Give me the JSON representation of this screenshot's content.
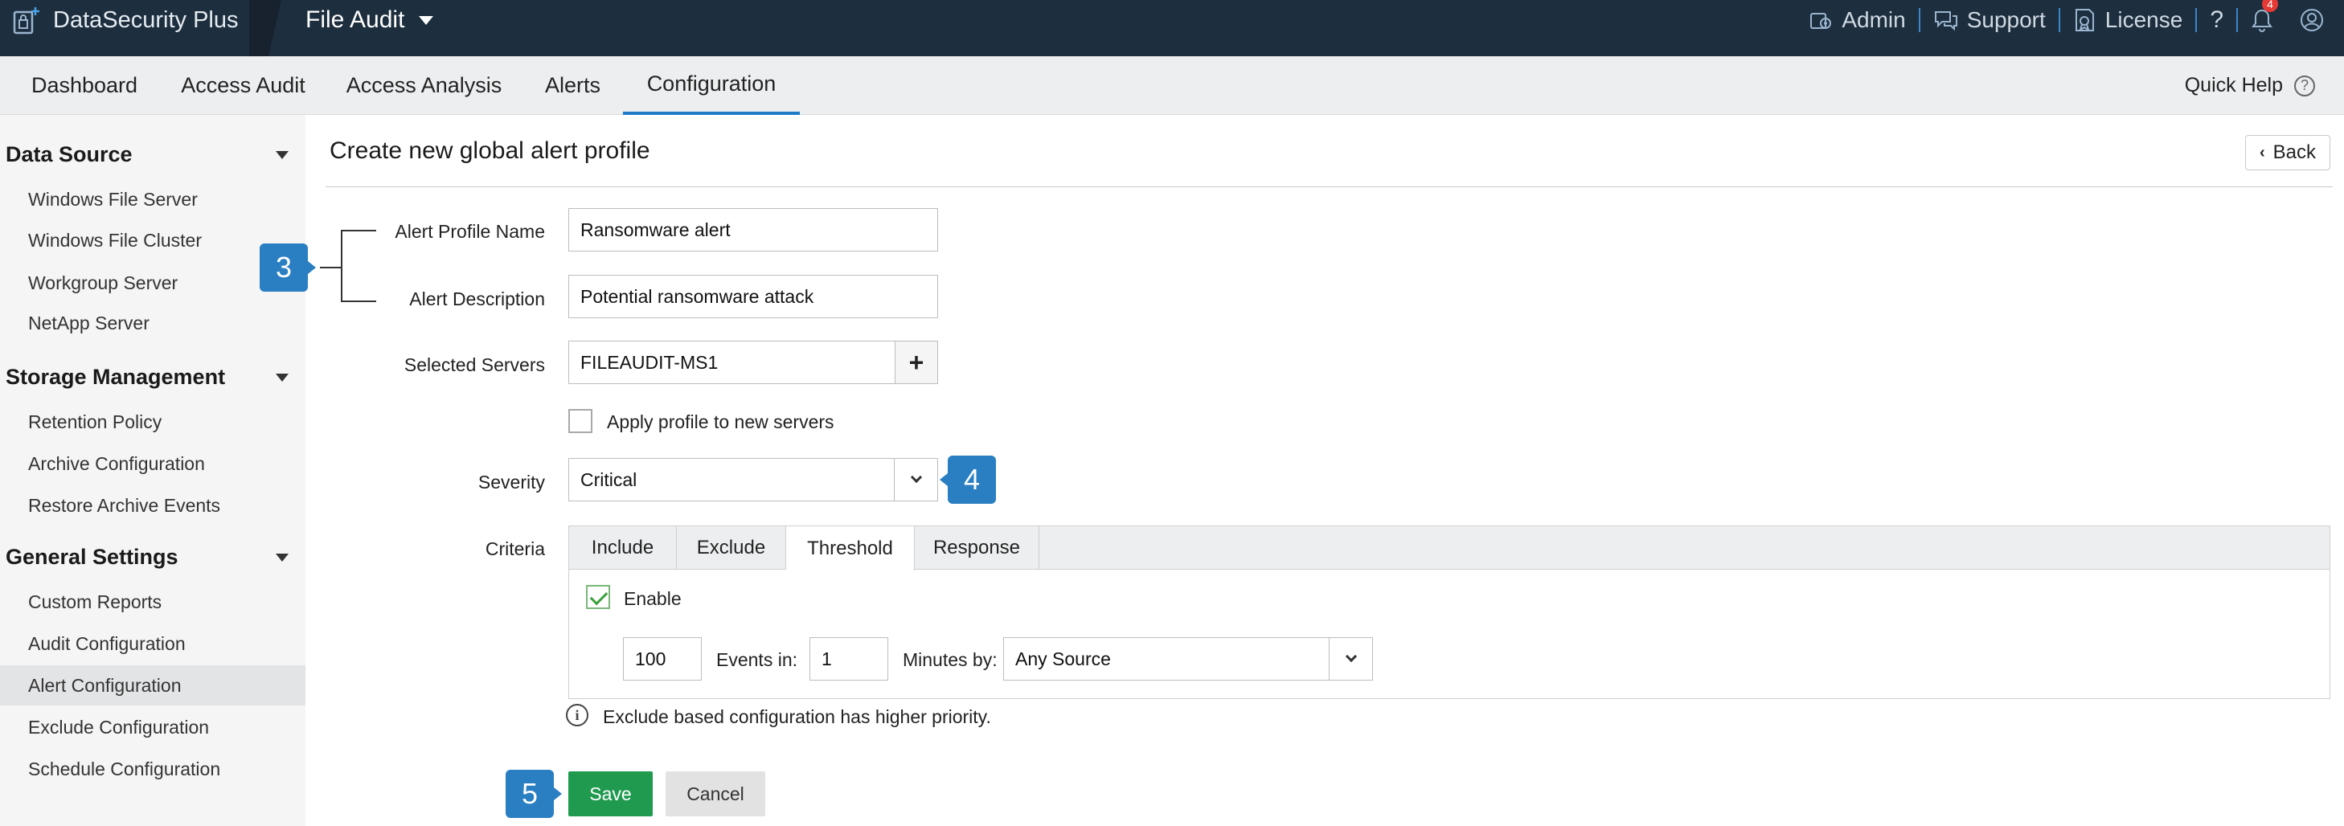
{
  "app": {
    "brand_name": "DataSecurity Plus",
    "product": "File Audit"
  },
  "top_links": {
    "admin": "Admin",
    "support": "Support",
    "license": "License",
    "help": "?",
    "notification_count": "4"
  },
  "nav": {
    "tabs": [
      "Dashboard",
      "Access Audit",
      "Access Analysis",
      "Alerts",
      "Configuration"
    ],
    "active": "Configuration",
    "quick_help": "Quick Help",
    "quick_help_icon": "?"
  },
  "sidebar": {
    "sections": [
      {
        "title": "Data Source",
        "items": [
          "Windows File Server",
          "Windows File Cluster",
          "Workgroup Server",
          "NetApp Server"
        ]
      },
      {
        "title": "Storage Management",
        "items": [
          "Retention Policy",
          "Archive Configuration",
          "Restore Archive Events"
        ]
      },
      {
        "title": "General Settings",
        "items": [
          "Custom Reports",
          "Audit Configuration",
          "Alert Configuration",
          "Exclude Configuration",
          "Schedule Configuration"
        ]
      }
    ],
    "active_item": "Alert Configuration"
  },
  "page": {
    "title": "Create new global alert profile",
    "back_label": "Back"
  },
  "form": {
    "profile_name_label": "Alert Profile Name",
    "profile_name_value": "Ransomware alert",
    "description_label": "Alert Description",
    "description_value": "Potential ransomware attack",
    "servers_label": "Selected Servers",
    "servers_value": "FILEAUDIT-MS1",
    "add_server_symbol": "+",
    "apply_new_servers_label": "Apply profile to new servers",
    "apply_new_servers_checked": false,
    "severity_label": "Severity",
    "severity_value": "Critical",
    "criteria_label": "Criteria"
  },
  "criteria": {
    "tabs": [
      "Include",
      "Exclude",
      "Threshold",
      "Response"
    ],
    "active_tab": "Threshold",
    "enable_label": "Enable",
    "enable_checked": true,
    "events_count": "100",
    "events_in_label": "Events in:",
    "minutes_value": "1",
    "minutes_by_label": "Minutes by:",
    "source_value": "Any Source"
  },
  "info": {
    "icon": "i",
    "text": "Exclude based configuration has higher priority."
  },
  "actions": {
    "save_label": "Save",
    "cancel_label": "Cancel"
  },
  "callouts": {
    "form_fields": "3",
    "severity": "4",
    "save": "5"
  },
  "colors": {
    "topbar": "#1d2e3e",
    "accent": "#1f7bc6",
    "callout": "#2a7fc2",
    "save": "#1f9a4f",
    "notification": "#e53935"
  }
}
